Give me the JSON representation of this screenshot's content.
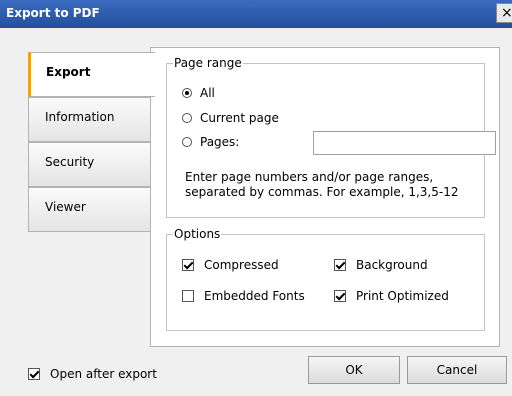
{
  "window": {
    "title": "Export to PDF",
    "close_label": "×"
  },
  "tabs": [
    {
      "label": "Export"
    },
    {
      "label": "Information"
    },
    {
      "label": "Security"
    },
    {
      "label": "Viewer"
    }
  ],
  "page_range": {
    "legend": "Page range",
    "all_label": "All",
    "current_label": "Current page",
    "pages_label": "Pages:",
    "pages_value": "",
    "hint_line1": "Enter page numbers and/or page ranges,",
    "hint_line2": "separated by commas. For example, 1,3,5-12",
    "selected": "All"
  },
  "options": {
    "legend": "Options",
    "compressed": {
      "label": "Compressed",
      "checked": true
    },
    "background": {
      "label": "Background",
      "checked": true
    },
    "embedded_fonts": {
      "label": "Embedded Fonts",
      "checked": false
    },
    "print_optimized": {
      "label": "Print Optimized",
      "checked": true
    }
  },
  "footer": {
    "open_after_export": {
      "label": "Open after export",
      "checked": true
    },
    "ok_label": "OK",
    "cancel_label": "Cancel"
  }
}
